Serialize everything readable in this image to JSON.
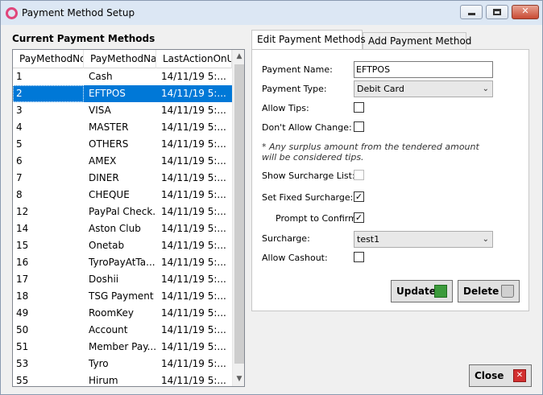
{
  "window": {
    "title": "Payment Method Setup"
  },
  "list": {
    "section_title": "Current Payment Methods",
    "columns": [
      "PayMethodNo",
      "PayMethodNan",
      "LastActionOnU"
    ],
    "rows": [
      [
        "1",
        "Cash",
        "14/11/19 5:..."
      ],
      [
        "2",
        "EFTPOS",
        "14/11/19 5:..."
      ],
      [
        "3",
        "VISA",
        "14/11/19 5:..."
      ],
      [
        "4",
        "MASTER",
        "14/11/19 5:..."
      ],
      [
        "5",
        "OTHERS",
        "14/11/19 5:..."
      ],
      [
        "6",
        "AMEX",
        "14/11/19 5:..."
      ],
      [
        "7",
        "DINER",
        "14/11/19 5:..."
      ],
      [
        "8",
        "CHEQUE",
        "14/11/19 5:..."
      ],
      [
        "12",
        "PayPal Check...",
        "14/11/19 5:..."
      ],
      [
        "14",
        "Aston Club",
        "14/11/19 5:..."
      ],
      [
        "15",
        "Onetab",
        "14/11/19 5:..."
      ],
      [
        "16",
        "TyroPayAtTa...",
        "14/11/19 5:..."
      ],
      [
        "17",
        "Doshii",
        "14/11/19 5:..."
      ],
      [
        "18",
        "TSG Payment",
        "14/11/19 5:..."
      ],
      [
        "49",
        "RoomKey",
        "14/11/19 5:..."
      ],
      [
        "50",
        "Account",
        "14/11/19 5:..."
      ],
      [
        "51",
        "Member Pay...",
        "14/11/19 5:..."
      ],
      [
        "53",
        "Tyro",
        "14/11/19 5:..."
      ],
      [
        "55",
        "Hirum",
        "14/11/19 5:..."
      ]
    ],
    "selected_index": 1
  },
  "tabs": {
    "edit": "Edit Payment Methods",
    "add": "Add Payment Method"
  },
  "form": {
    "payment_name_label": "Payment Name:",
    "payment_name_value": "EFTPOS",
    "payment_type_label": "Payment Type:",
    "payment_type_value": "Debit Card",
    "allow_tips_label": "Allow Tips:",
    "allow_tips": false,
    "dont_allow_change_label": "Don't Allow Change:",
    "dont_allow_change": false,
    "note": "* Any surplus amount from the tendered amount will be considered tips.",
    "show_surcharge_list_label": "Show Surcharge List:",
    "show_surcharge_list": false,
    "set_fixed_surcharge_label": "Set Fixed Surcharge:",
    "set_fixed_surcharge": true,
    "prompt_to_confirm_label": "Prompt to Confirm",
    "prompt_to_confirm": true,
    "surcharge_label": "Surcharge:",
    "surcharge_value": "test1",
    "allow_cashout_label": "Allow Cashout:",
    "allow_cashout": false
  },
  "buttons": {
    "update": "Update",
    "delete": "Delete",
    "close": "Close"
  },
  "icons": {
    "app": "app-ring-icon",
    "update": "refresh-icon",
    "delete": "trash-icon",
    "close": "close-x-icon"
  },
  "colors": {
    "selection": "#0078d7",
    "title_bar": "#dce7f4"
  }
}
